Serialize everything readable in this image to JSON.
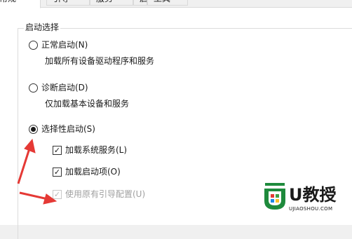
{
  "tabs": [
    {
      "label": "常规",
      "active": true
    },
    {
      "label": "引导",
      "active": false
    },
    {
      "label": "服务",
      "active": false
    },
    {
      "label": "启动",
      "active": false
    },
    {
      "label": "工具",
      "active": false
    }
  ],
  "group": {
    "title": "启动选择"
  },
  "options": {
    "normal": {
      "label": "正常启动(N)",
      "description": "加载所有设备驱动程序和服务",
      "selected": false
    },
    "diagnostic": {
      "label": "诊断启动(D)",
      "description": "仅加载基本设备和服务",
      "selected": false
    },
    "selective": {
      "label": "选择性启动(S)",
      "selected": true
    }
  },
  "selective_items": {
    "load_services": {
      "label": "加载系统服务(L)",
      "checked": true,
      "enabled": true
    },
    "load_startup": {
      "label": "加载启动项(O)",
      "checked": true,
      "enabled": true
    },
    "use_original_boot": {
      "label": "使用原有引导配置(U)",
      "checked": true,
      "enabled": false
    }
  },
  "annotation": {
    "arrow_color": "#e53935"
  },
  "watermark": {
    "brand": "U教授",
    "url": "UJIAOSHOU.COM",
    "logo_color": "#1e8a3c"
  }
}
